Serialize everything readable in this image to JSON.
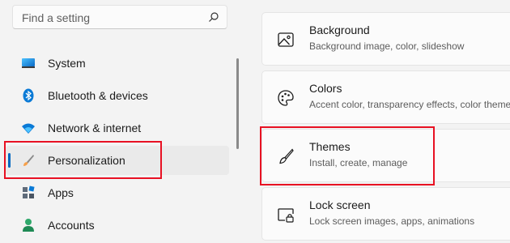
{
  "search": {
    "placeholder": "Find a setting",
    "icon": "search-icon"
  },
  "nav": {
    "items": [
      {
        "label": "System",
        "icon": "monitor-icon"
      },
      {
        "label": "Bluetooth & devices",
        "icon": "bluetooth-icon"
      },
      {
        "label": "Network & internet",
        "icon": "wifi-icon"
      },
      {
        "label": "Personalization",
        "icon": "paintbrush-icon",
        "selected": true
      },
      {
        "label": "Apps",
        "icon": "apps-icon"
      },
      {
        "label": "Accounts",
        "icon": "person-icon"
      }
    ]
  },
  "cards": [
    {
      "title": "Background",
      "subtitle": "Background image, color, slideshow",
      "icon": "image-icon"
    },
    {
      "title": "Colors",
      "subtitle": "Accent color, transparency effects, color theme",
      "icon": "palette-icon"
    },
    {
      "title": "Themes",
      "subtitle": "Install, create, manage",
      "icon": "brush-icon"
    },
    {
      "title": "Lock screen",
      "subtitle": "Lock screen images, apps, animations",
      "icon": "lock-screen-icon"
    }
  ],
  "colors": {
    "accent": "#0067c0",
    "highlight": "#e81123"
  }
}
